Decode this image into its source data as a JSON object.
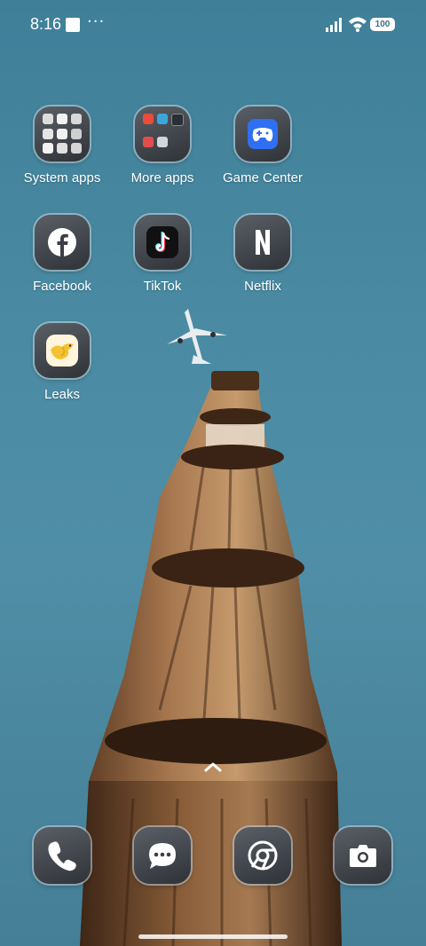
{
  "status_bar": {
    "time": "8:16",
    "more": "···",
    "battery": "100"
  },
  "apps": [
    {
      "label": "System apps",
      "icon": "folder-icon"
    },
    {
      "label": "More apps",
      "icon": "folder-icon"
    },
    {
      "label": "Game Center",
      "icon": "gamepad-icon"
    },
    {
      "label": "Facebook",
      "icon": "facebook-icon"
    },
    {
      "label": "TikTok",
      "icon": "tiktok-icon"
    },
    {
      "label": "Netflix",
      "icon": "netflix-icon"
    },
    {
      "label": "Leaks",
      "icon": "bird-icon"
    }
  ],
  "dock": [
    {
      "icon": "phone-icon"
    },
    {
      "icon": "messages-icon"
    },
    {
      "icon": "chrome-icon"
    },
    {
      "icon": "camera-icon"
    }
  ]
}
